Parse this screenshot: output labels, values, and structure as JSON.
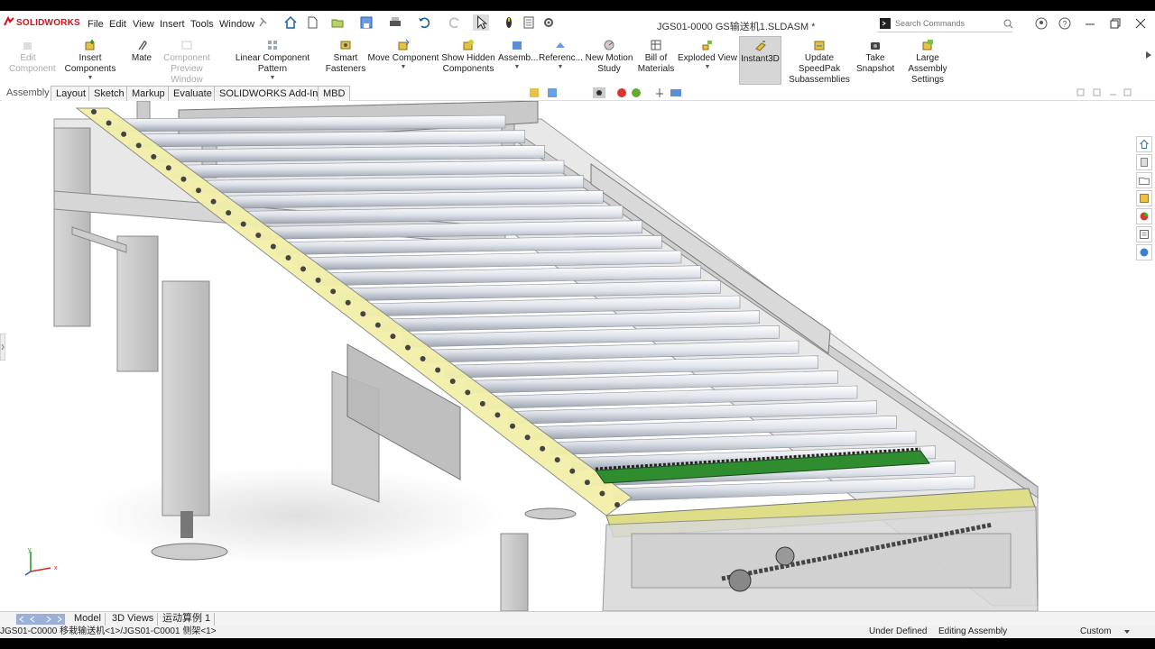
{
  "app": {
    "logo_text": "SOLIDWORKS",
    "brand_color": "#d2131b"
  },
  "window": {
    "title": "JGS01-0000 GS输送机1.SLDASM *"
  },
  "menu": [
    "File",
    "Edit",
    "View",
    "Insert",
    "Tools",
    "Window"
  ],
  "search": {
    "placeholder": "Search Commands"
  },
  "commands": {
    "edit_component": "Edit Component",
    "insert_components": "Insert Components",
    "mate": "Mate",
    "component_preview": "Component Preview Window",
    "linear_pattern": "Linear Component Pattern",
    "smart_fasteners": "Smart Fasteners",
    "move_component": "Move Component",
    "show_hidden": "Show Hidden Components",
    "assembly_features": "Assemb...",
    "reference_geometry": "Referenc...",
    "new_motion_study": "New Motion Study",
    "bill_of_materials": "Bill of Materials",
    "exploded_view": "Exploded View",
    "instant3d": "Instant3D",
    "update_speedpak": "Update SpeedPak Subassemblies",
    "take_snapshot": "Take Snapshot",
    "large_assembly": "Large Assembly Settings"
  },
  "tabs": [
    "Assembly",
    "Layout",
    "Sketch",
    "Markup",
    "Evaluate",
    "SOLIDWORKS Add-Ins",
    "MBD"
  ],
  "bottom_tabs": [
    "Model",
    "3D Views",
    "运动算例 1"
  ],
  "status": {
    "path": "JGS01-C0000 移栽输送机<1>/JGS01-C0001 侧架<1>",
    "define_state": "Under Defined",
    "mode": "Editing Assembly",
    "units": "Custom"
  },
  "triad": {
    "x": "x",
    "y": "y"
  }
}
